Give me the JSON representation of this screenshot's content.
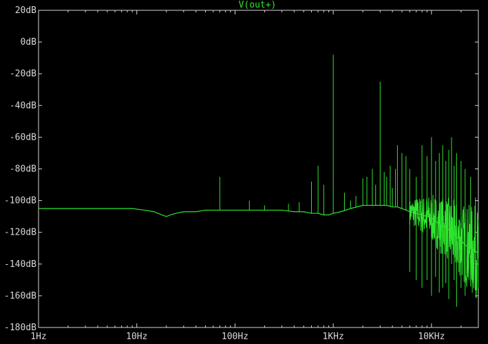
{
  "window": {
    "background": "#000000",
    "axis_color": "#d8d8d8",
    "trace_color": "#2ee62e"
  },
  "chart_data": {
    "type": "line",
    "title": "V(out+)",
    "xlabel": "",
    "ylabel": "",
    "x_scale": "log",
    "xlim": [
      1,
      30000
    ],
    "ylim": [
      -180,
      20
    ],
    "grid": false,
    "x_ticks": [
      {
        "value": 1,
        "label": "1Hz"
      },
      {
        "value": 10,
        "label": "10Hz"
      },
      {
        "value": 100,
        "label": "100Hz"
      },
      {
        "value": 1000,
        "label": "1KHz"
      },
      {
        "value": 10000,
        "label": "10KHz"
      }
    ],
    "y_ticks": [
      {
        "value": 20,
        "label": "20dB"
      },
      {
        "value": 0,
        "label": "0dB"
      },
      {
        "value": -20,
        "label": "-20dB"
      },
      {
        "value": -40,
        "label": "-40dB"
      },
      {
        "value": -60,
        "label": "-60dB"
      },
      {
        "value": -80,
        "label": "-80dB"
      },
      {
        "value": -100,
        "label": "-100dB"
      },
      {
        "value": -120,
        "label": "-120dB"
      },
      {
        "value": -140,
        "label": "-140dB"
      },
      {
        "value": -160,
        "label": "-160dB"
      },
      {
        "value": -180,
        "label": "-180dB"
      }
    ],
    "series": [
      {
        "name": "V(out+)",
        "x": [
          1,
          2,
          4,
          7,
          9,
          12,
          15,
          18,
          20,
          22,
          25,
          30,
          40,
          50,
          60,
          70,
          80,
          100,
          150,
          200,
          300,
          400,
          500,
          600,
          700,
          800,
          900,
          1000,
          1200,
          1500,
          2000,
          2500,
          3000,
          3500,
          4000,
          4500,
          5000,
          5500,
          6000,
          7000,
          8000,
          9000,
          10000,
          11000,
          12000,
          14000,
          16000,
          18000,
          20000,
          22000,
          25000,
          28000,
          30000
        ],
        "y": [
          -105,
          -105,
          -105,
          -105,
          -105,
          -106,
          -107,
          -109,
          -110,
          -109,
          -108,
          -107,
          -107,
          -106,
          -106,
          -106,
          -106,
          -106,
          -106,
          -106,
          -106,
          -107,
          -107,
          -108,
          -108,
          -109,
          -109,
          -108,
          -107,
          -105,
          -103,
          -103,
          -103,
          -103,
          -104,
          -104,
          -105,
          -106,
          -107,
          -108,
          -109,
          -110,
          -111,
          -113,
          -115,
          -117,
          -120,
          -123,
          -125,
          -128,
          -130,
          -132,
          -133
        ]
      }
    ],
    "spikes": {
      "x": [
        70,
        140,
        200,
        350,
        450,
        600,
        700,
        800,
        1000,
        1300,
        1500,
        1700,
        2000,
        2200,
        2500,
        2700,
        3000,
        3300,
        3500,
        3800,
        4000,
        4300,
        4500,
        5000,
        5500,
        6000,
        7000,
        8000,
        9000,
        10000,
        11000,
        12000,
        13000,
        14000,
        15000,
        16000,
        17000,
        18000,
        20000,
        22000,
        25000,
        28000
      ],
      "y": [
        -85,
        -100,
        -103,
        -102,
        -101,
        -88,
        -78,
        -90,
        -8,
        -95,
        -100,
        -97,
        -86,
        -85,
        -80,
        -90,
        -25,
        -82,
        -85,
        -78,
        -92,
        -80,
        -65,
        -70,
        -72,
        -80,
        -85,
        -65,
        -72,
        -60,
        -75,
        -70,
        -65,
        -75,
        -68,
        -60,
        -78,
        -70,
        -75,
        -80,
        -85,
        -98
      ]
    },
    "noise_floor": {
      "x": [
        6000,
        7000,
        8000,
        9000,
        10000,
        11000,
        12000,
        13000,
        14000,
        15000,
        16000,
        17000,
        18000,
        19000,
        20000,
        22000,
        24000,
        26000,
        28000,
        30000
      ],
      "y": [
        -145,
        -150,
        -155,
        -150,
        -160,
        -148,
        -158,
        -155,
        -152,
        -162,
        -140,
        -150,
        -167,
        -145,
        -155,
        -160,
        -150,
        -158,
        -152,
        -155
      ]
    }
  }
}
